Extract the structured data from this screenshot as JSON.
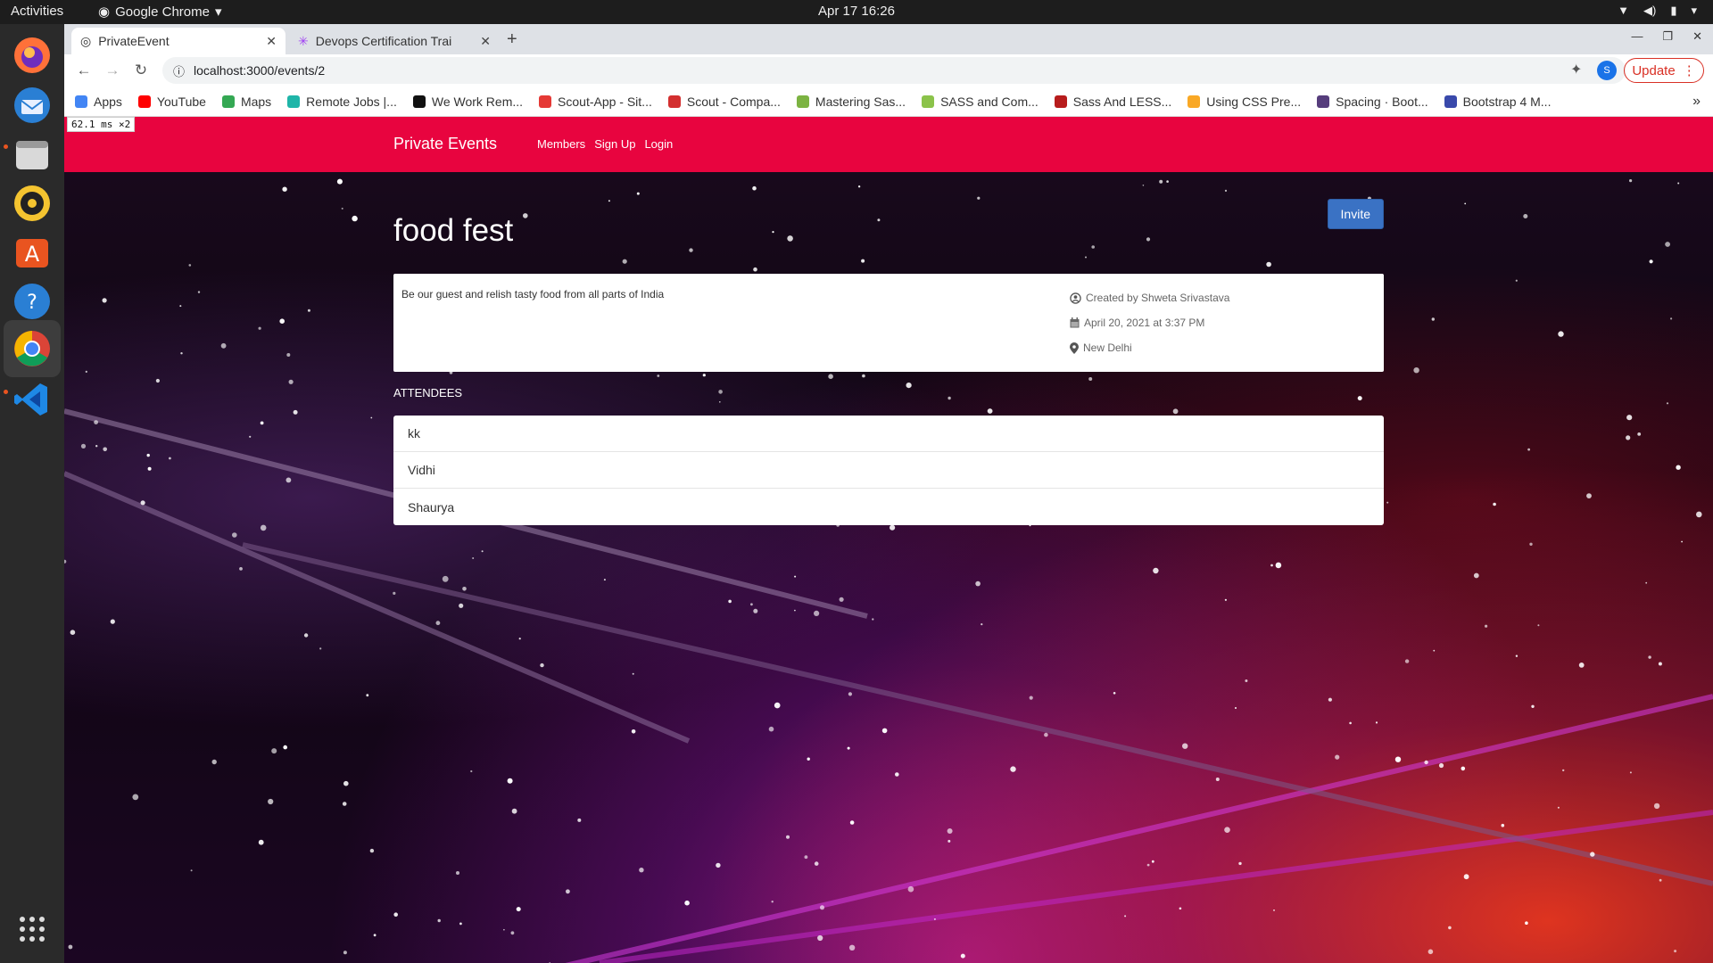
{
  "system_bar": {
    "activities": "Activities",
    "app_name": "Google Chrome",
    "datetime": "Apr 17  16:26"
  },
  "browser": {
    "tabs": [
      {
        "title": "PrivateEvent",
        "active": true
      },
      {
        "title": "Devops Certification Trai",
        "active": false
      }
    ],
    "url": "localhost:3000/events/2",
    "update_label": "Update",
    "profile_initial": "S",
    "bookmarks": [
      {
        "label": "Apps",
        "color": "#4285f4"
      },
      {
        "label": "YouTube",
        "color": "#ff0000"
      },
      {
        "label": "Maps",
        "color": "#34a853"
      },
      {
        "label": "Remote Jobs |...",
        "color": "#1fb5a8"
      },
      {
        "label": "We Work Rem...",
        "color": "#111111"
      },
      {
        "label": "Scout-App - Sit...",
        "color": "#e53935"
      },
      {
        "label": "Scout - Compa...",
        "color": "#d32f2f"
      },
      {
        "label": "Mastering Sas...",
        "color": "#7cb342"
      },
      {
        "label": "SASS and Com...",
        "color": "#8bc34a"
      },
      {
        "label": "Sass And LESS...",
        "color": "#b71c1c"
      },
      {
        "label": "Using CSS Pre...",
        "color": "#f9a825"
      },
      {
        "label": "Spacing · Boot...",
        "color": "#563d7c"
      },
      {
        "label": "Bootstrap 4 M...",
        "color": "#3949ab"
      }
    ]
  },
  "fps_overlay": "62.1 ms ×2",
  "site": {
    "brand": "Private Events",
    "nav": [
      "Members",
      "Sign Up",
      "Login"
    ],
    "accent_color": "#e8043f"
  },
  "event": {
    "title": "food fest",
    "invite_label": "Invite",
    "description": "Be our guest and relish tasty food from all parts of India",
    "created_by": "Created by Shweta Srivastava",
    "date": "April 20, 2021 at 3:37 PM",
    "location": "New Delhi",
    "attendees_label": "ATTENDEES",
    "attendees": [
      "kk",
      "Vidhi",
      "Shaurya"
    ]
  }
}
